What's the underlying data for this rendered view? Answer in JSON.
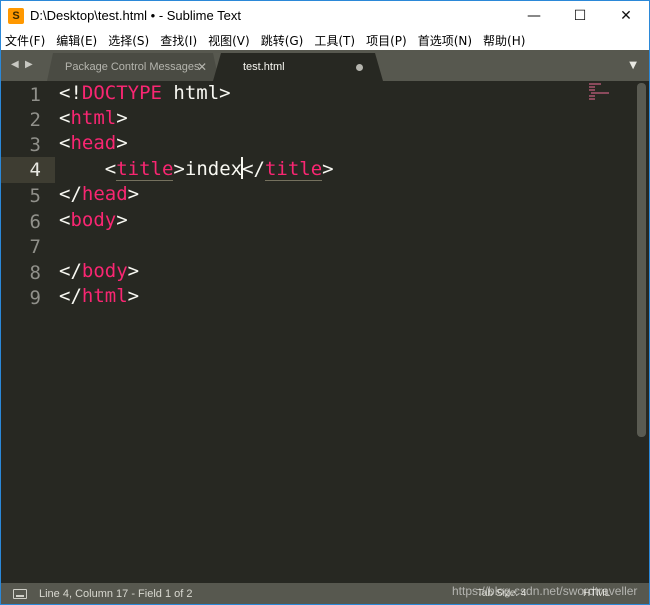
{
  "window": {
    "app_icon": "S",
    "title": "D:\\Desktop\\test.html • - Sublime Text",
    "controls": {
      "minimize": "—",
      "maximize": "☐",
      "close": "✕"
    }
  },
  "menu": {
    "items": [
      "文件(F)",
      "编辑(E)",
      "选择(S)",
      "查找(I)",
      "视图(V)",
      "跳转(G)",
      "工具(T)",
      "项目(P)",
      "首选项(N)",
      "帮助(H)"
    ]
  },
  "tabs": {
    "nav_left": "◀",
    "nav_right": "▶",
    "items": [
      {
        "label": "Package Control Messages",
        "active": false,
        "close": "✕"
      },
      {
        "label": "test.html",
        "active": true,
        "dirty": true
      }
    ],
    "dropdown": "▼"
  },
  "editor": {
    "line_numbers": [
      "1",
      "2",
      "3",
      "4",
      "5",
      "6",
      "7",
      "8",
      "9"
    ],
    "current_line": 4,
    "lines": {
      "l1": {
        "lt": "<!",
        "kw": "DOCTYPE",
        "rest": " html>"
      },
      "l2": {
        "open": "<",
        "tag": "html",
        "close": ">"
      },
      "l3": {
        "open": "<",
        "tag": "head",
        "close": ">"
      },
      "l4": {
        "indent": "    ",
        "open": "<",
        "tag": "title",
        "close": ">",
        "text_before_caret": "index",
        "close_open": "</",
        "close_tag": "title",
        "close_close": ">"
      },
      "l5": {
        "open": "</",
        "tag": "head",
        "close": ">"
      },
      "l6": {
        "open": "<",
        "tag": "body",
        "close": ">"
      },
      "l8": {
        "open": "</",
        "tag": "body",
        "close": ">"
      },
      "l9": {
        "open": "</",
        "tag": "html",
        "close": ">"
      }
    }
  },
  "statusbar": {
    "position": "Line 4, Column 17 - Field 1 of 2",
    "tab_size": "Tab Size: 4",
    "syntax": "HTML"
  },
  "watermark": "https://blog.csdn.net/swordtraveller",
  "colors": {
    "editor_bg": "#272822",
    "tag": "#f92672",
    "text": "#f8f8f2",
    "gutter_text": "#90908a",
    "chrome": "#57584f"
  }
}
